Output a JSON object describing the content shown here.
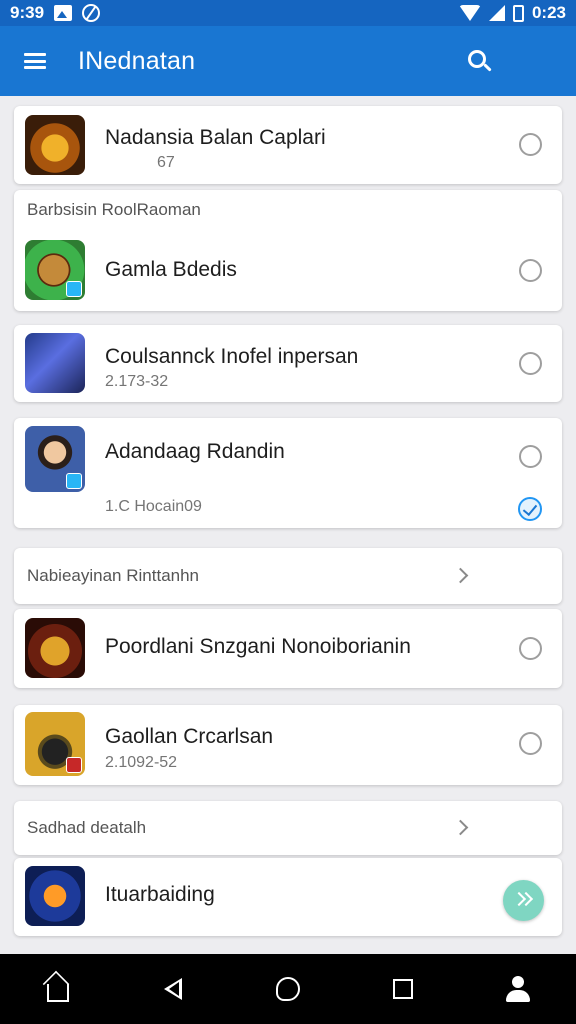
{
  "status_bar": {
    "time": "9:39",
    "clock": "0:23"
  },
  "app_bar": {
    "title": "INednatan"
  },
  "items": [
    {
      "name": "Nadansia Balan Caplari",
      "sub": "67",
      "icon": "golden-shell-game-icon"
    },
    {
      "name": "Gamla Bdedis",
      "sub": "",
      "icon": "cartoon-creature-game-icon"
    },
    {
      "name": "Coulsannck Inofel inpersan",
      "sub": "2.173-32",
      "icon": "dragon-game-icon"
    },
    {
      "name": "Adandaag Rdandin",
      "sub": "1.C Hocain09",
      "icon": "portrait-game-icon"
    },
    {
      "name": "Poordlani Snzgani Nonoiborianin",
      "sub": "",
      "icon": "lion-emblem-game-icon"
    },
    {
      "name": "Gaollan Crcarlsan",
      "sub": "2.1092-52",
      "icon": "helmet-game-icon"
    },
    {
      "name": "Ituarbaiding",
      "sub": "",
      "icon": "logo-game-icon"
    }
  ],
  "sections": [
    {
      "label": "Barbsisin RoolRaoman"
    },
    {
      "label": "Nabieayinan Rinttanhn"
    },
    {
      "label": "Sadhad deatalh"
    }
  ],
  "nav": [
    {
      "icon": "home-icon"
    },
    {
      "icon": "back-icon"
    },
    {
      "icon": "share-icon"
    },
    {
      "icon": "recent-apps-icon"
    },
    {
      "icon": "profile-icon"
    }
  ],
  "colors": {
    "status_bar": "#1565c0",
    "app_bar": "#1976d2",
    "background": "#ededf0",
    "fab": "#7fd6c2",
    "nav_bar": "#000000"
  }
}
